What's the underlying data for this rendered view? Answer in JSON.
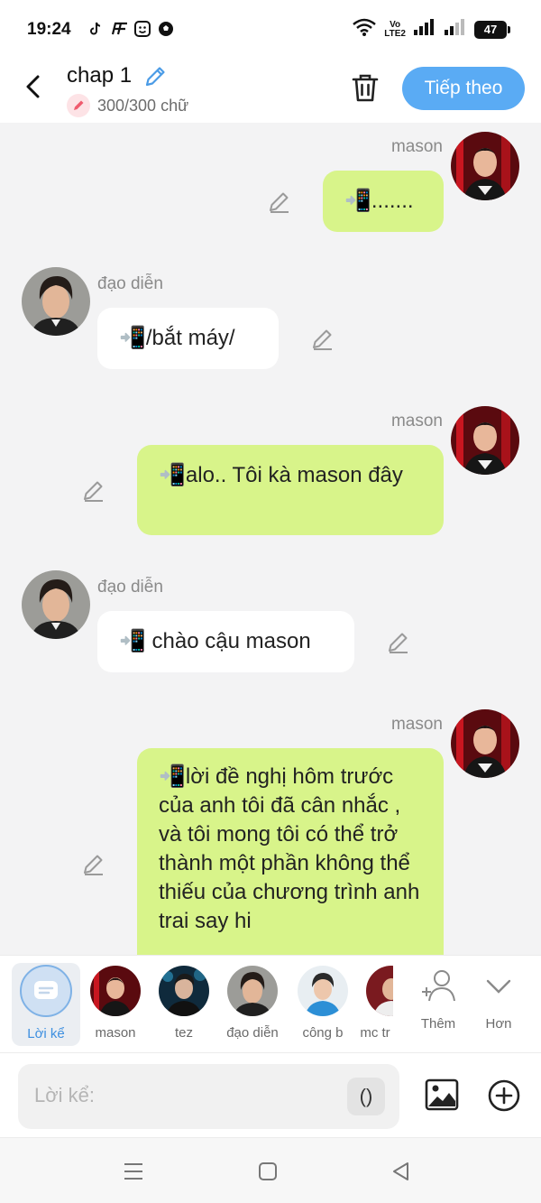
{
  "status_bar": {
    "time": "19:24",
    "volte_line1": "Vo",
    "volte_line2": "LTE2",
    "battery": "47"
  },
  "header": {
    "title": "chap 1",
    "word_count": "300/300 chữ",
    "next_button": "Tiếp theo"
  },
  "messages": [
    {
      "side": "right",
      "speaker": "mason",
      "text": "📲.......",
      "avatar": "mason"
    },
    {
      "side": "left",
      "speaker": "đạo diễn",
      "text": "📲/bắt máy/",
      "avatar": "dao-dien"
    },
    {
      "side": "right",
      "speaker": "mason",
      "text": "📲alo.. Tôi kà mason đây",
      "avatar": "mason"
    },
    {
      "side": "left",
      "speaker": "đạo diễn",
      "text": "📲 chào cậu mason",
      "avatar": "dao-dien"
    },
    {
      "side": "right",
      "speaker": "mason",
      "text": "📲lời đề nghị hôm trước của anh tôi đã cân nhắc , và tôi mong tôi có thể trở thành một phần không thể thiếu của chương trình anh trai say hi",
      "avatar": "mason"
    }
  ],
  "characters": {
    "narration_label": "Lời kể",
    "items": [
      {
        "label": "mason"
      },
      {
        "label": "tez"
      },
      {
        "label": "đạo diễn"
      },
      {
        "label": "công b"
      },
      {
        "label": "mc tr"
      }
    ],
    "add_label": "Thêm",
    "more_label": "Hơn"
  },
  "input": {
    "placeholder": "Lời kể:",
    "paren_button": "()"
  },
  "colors": {
    "accent": "#5aabf4",
    "bubble_right": "#d8f48a",
    "bubble_left": "#ffffff",
    "chat_bg": "#f3f3f4"
  }
}
